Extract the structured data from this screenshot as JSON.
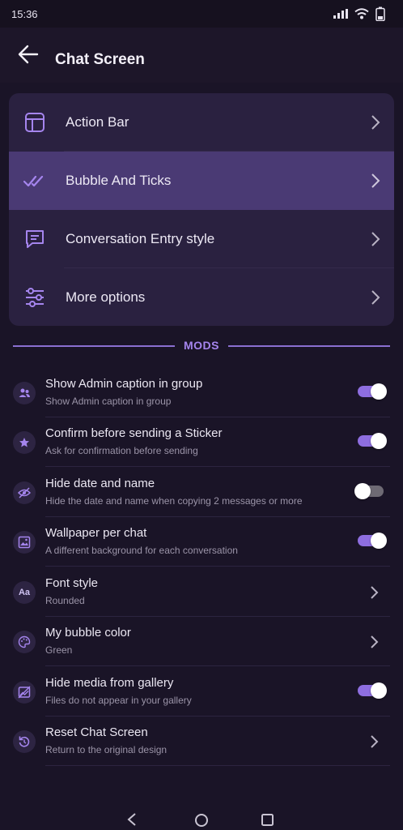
{
  "status_bar": {
    "time": "15:36"
  },
  "header": {
    "title": "Chat Screen"
  },
  "menu": [
    {
      "label": "Action Bar",
      "icon": "layout-icon",
      "active": false
    },
    {
      "label": "Bubble And Ticks",
      "icon": "double-check-icon",
      "active": true
    },
    {
      "label": "Conversation Entry style",
      "icon": "chat-bubble-icon",
      "active": false
    },
    {
      "label": "More options",
      "icon": "sliders-icon",
      "active": false
    }
  ],
  "section_title": "MODS",
  "mods": [
    {
      "title": "Show Admin caption in group",
      "subtitle": "Show Admin caption in group",
      "icon": "admin-group-icon",
      "control": "toggle",
      "on": true
    },
    {
      "title": "Confirm before sending a Sticker",
      "subtitle": "Ask for confirmation before sending",
      "icon": "star-icon",
      "control": "toggle",
      "on": true
    },
    {
      "title": "Hide date and name",
      "subtitle": "Hide the date and name when copying 2 messages or more",
      "icon": "eye-off-icon",
      "control": "toggle",
      "on": false
    },
    {
      "title": "Wallpaper per chat",
      "subtitle": "A different background for each conversation",
      "icon": "wallpaper-icon",
      "control": "toggle",
      "on": true
    },
    {
      "title": "Font style",
      "subtitle": "Rounded",
      "icon": "font-icon",
      "icon_text": "Aa",
      "control": "chevron"
    },
    {
      "title": "My bubble color",
      "subtitle": "Green",
      "icon": "palette-icon",
      "control": "chevron"
    },
    {
      "title": "Hide media from gallery",
      "subtitle": "Files do not appear in your gallery",
      "icon": "hide-media-icon",
      "control": "toggle",
      "on": true
    },
    {
      "title": "Reset Chat Screen",
      "subtitle": "Return to the original design",
      "icon": "reset-icon",
      "control": "chevron"
    }
  ],
  "colors": {
    "accent": "#8e6ee0",
    "background": "#1a1427",
    "card": "#2a2140",
    "active_row": "#4a3a74"
  }
}
